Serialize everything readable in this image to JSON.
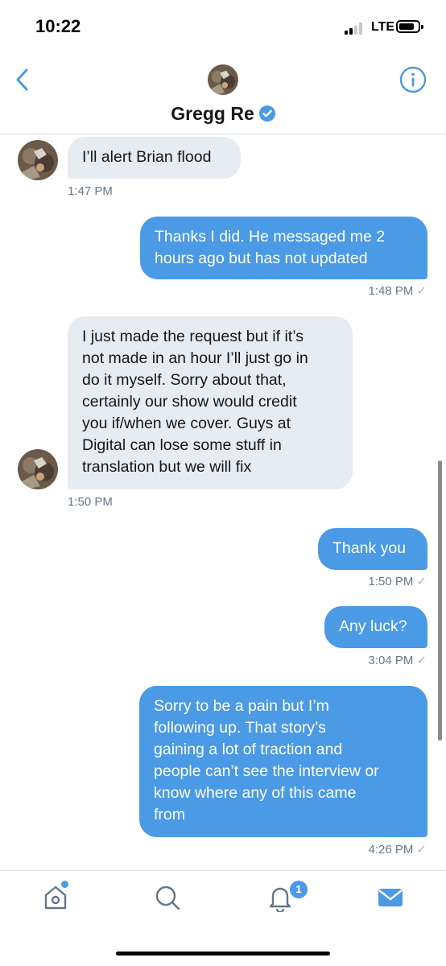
{
  "status_bar": {
    "time": "10:22",
    "network": "LTE"
  },
  "header": {
    "name": "Gregg Re",
    "verified": true
  },
  "messages": [
    {
      "side": "in",
      "text": "I’ll alert Brian flood",
      "time": "1:47 PM"
    },
    {
      "side": "out",
      "text": "Thanks I did. He messaged me 2\nhours ago but has not updated",
      "time": "1:48 PM"
    },
    {
      "side": "in",
      "text": "I just made the request but if it’s\nnot made in an hour I’ll just go in\ndo it myself. Sorry about that,\ncertainly our show would credit\nyou if/when we cover. Guys at\nDigital can lose some stuff in\ntranslation but we will fix",
      "time": "1:50 PM"
    },
    {
      "side": "out",
      "text": "Thank you",
      "time": "1:50 PM"
    },
    {
      "side": "out",
      "text": "Any luck?",
      "time": "3:04 PM"
    },
    {
      "side": "out",
      "text": "Sorry to be a pain but I’m\nfollowing up. That story’s\ngaining a lot of traction and\npeople can’t see the interview or\nknow where any of this came\nfrom",
      "time": "4:26 PM"
    }
  ],
  "tab_bar": {
    "items": [
      "home-icon",
      "search-icon",
      "notifications-icon",
      "messages-icon"
    ],
    "notifications_count": "1"
  },
  "colors": {
    "accent": "#4a9ae6",
    "incoming_bubble": "#e6ecf0"
  }
}
